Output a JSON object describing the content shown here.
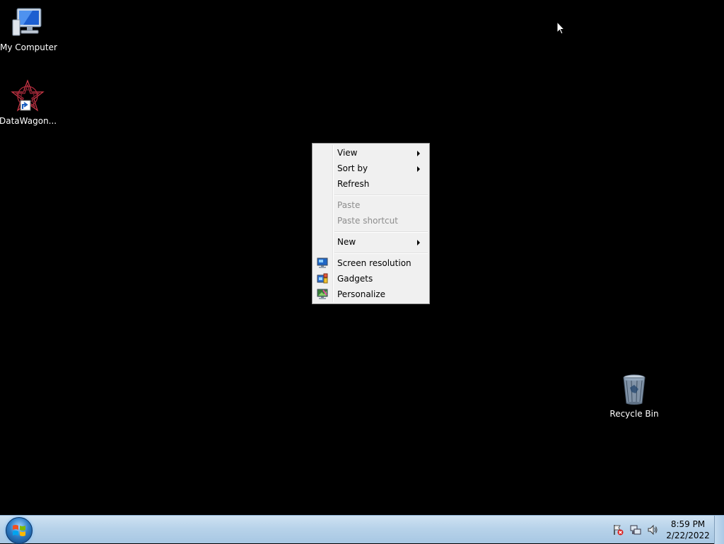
{
  "desktop": {
    "icons": [
      {
        "label": "My Computer",
        "icon": "computer-icon"
      },
      {
        "label": "DataWagon...",
        "icon": "datawagon-shortcut-icon"
      },
      {
        "label": "Recycle Bin",
        "icon": "recycle-bin-icon"
      }
    ]
  },
  "context_menu": {
    "items": [
      {
        "label": "View",
        "submenu": true,
        "enabled": true
      },
      {
        "label": "Sort by",
        "submenu": true,
        "enabled": true
      },
      {
        "label": "Refresh",
        "submenu": false,
        "enabled": true
      },
      {
        "label": "Paste",
        "submenu": false,
        "enabled": false
      },
      {
        "label": "Paste shortcut",
        "submenu": false,
        "enabled": false
      },
      {
        "label": "New",
        "submenu": true,
        "enabled": true
      },
      {
        "label": "Screen resolution",
        "submenu": false,
        "enabled": true,
        "icon": "screen-resolution-icon"
      },
      {
        "label": "Gadgets",
        "submenu": false,
        "enabled": true,
        "icon": "gadgets-icon"
      },
      {
        "label": "Personalize",
        "submenu": false,
        "enabled": true,
        "icon": "personalize-icon"
      }
    ]
  },
  "taskbar": {
    "start_icon": "windows-logo-icon",
    "tray_icons": [
      "action-center-flag-icon",
      "network-icon",
      "volume-icon"
    ],
    "clock": {
      "time": "8:59 PM",
      "date": "2/22/2022"
    }
  },
  "colors": {
    "desktop_background": "#000000",
    "menu_background": "#f0f0f0",
    "disabled_text": "#8d8d8d",
    "taskbar_top": "#cfe2f2"
  }
}
